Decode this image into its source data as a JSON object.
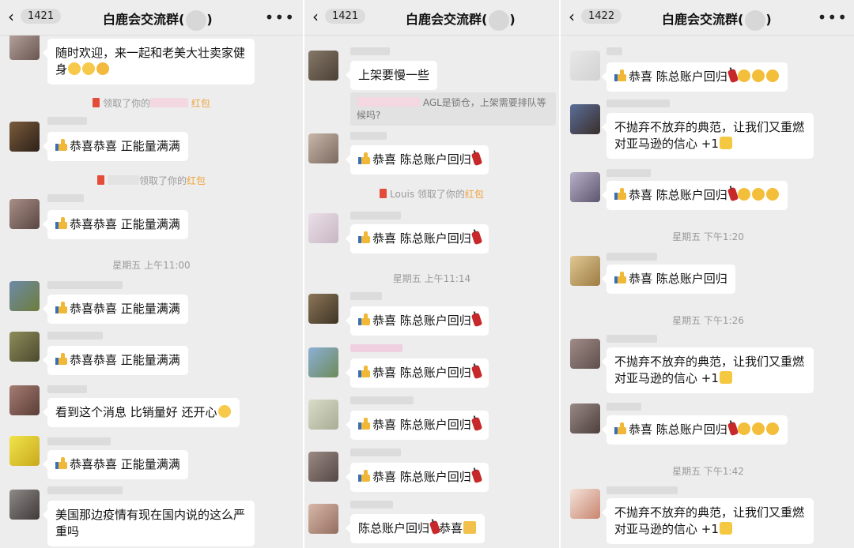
{
  "panels": [
    {
      "header": {
        "count": "1421",
        "title": "白鹿会交流群("
      },
      "bubbles": {
        "b1": "随时欢迎，来一起和老美大壮卖家健身",
        "b2": "恭喜恭喜 正能量满满",
        "b3": "恭喜恭喜 正能量满满",
        "b4": "恭喜恭喜 正能量满满",
        "b5": "恭喜恭喜 正能量满满",
        "b6": "看到这个消息 比销量好 还开心",
        "b7": "恭喜恭喜 正能量满满",
        "b8": "美国那边疫情有现在国内说的这么严重吗"
      },
      "sys1": {
        "pre": "领取了你的",
        "link": "红包"
      },
      "sys2": {
        "pre": "领取了你的",
        "link": "红包"
      },
      "time1": "星期五 上午11:00"
    },
    {
      "header": {
        "count": "1421",
        "title": "白鹿会交流群("
      },
      "bubbles": {
        "b1": "上架要慢一些",
        "quote": "AGL是锁仓，上架需要排队等候吗?",
        "b2": "恭喜 陈总账户回归",
        "b3": "恭喜 陈总账户回归",
        "b4": "恭喜 陈总账户回归",
        "b5": "恭喜 陈总账户回归",
        "b6": "恭喜 陈总账户回归",
        "b7": "恭喜 陈总账户回归",
        "b8a": "陈总账户回归",
        "b8b": "恭喜"
      },
      "sys1": {
        "pre": "Louis 领取了你的",
        "link": "红包"
      },
      "time1": "星期五 上午11:14"
    },
    {
      "header": {
        "count": "1422",
        "title": "白鹿会交流群("
      },
      "bubbles": {
        "b1": "恭喜 陈总账户回归",
        "b2": "不抛弃不放弃的典范，让我们又重燃对亚马逊的信心 +1",
        "b3": "恭喜 陈总账户回归",
        "b4": "恭喜 陈总账户回归",
        "b5": "不抛弃不放弃的典范，让我们又重燃对亚马逊的信心 +1",
        "b6": "恭喜 陈总账户回归",
        "b7": "不抛弃不放弃的典范，让我们又重燃对亚马逊的信心 +1"
      },
      "time1": "星期五 下午1:20",
      "time2": "星期五 下午1:26",
      "time3": "星期五 下午1:42"
    }
  ],
  "colors": {
    "background": "#ededed",
    "bubble": "#ffffff",
    "red_packet_link": "#f0a23c",
    "system_text": "#9a9a9a"
  },
  "icons": [
    "back-chevron-icon",
    "more-dots-icon",
    "thumbs-up-icon",
    "firecracker-icon",
    "red-packet-icon",
    "laughing-crying-emoji",
    "party-emoji",
    "banana-icon"
  ]
}
